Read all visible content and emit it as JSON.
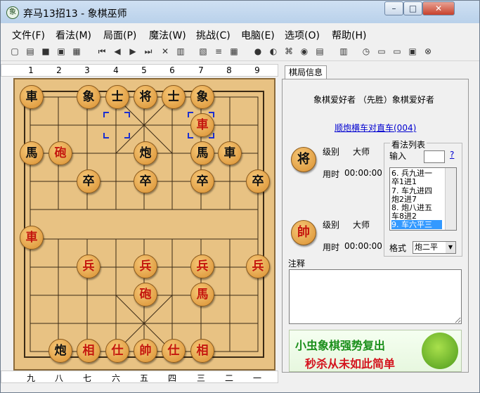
{
  "window": {
    "title": "弃马13招13 - 象棋巫师",
    "app_icon": "象"
  },
  "menu": [
    "文件(F)",
    "看法(M)",
    "局面(P)",
    "魔法(W)",
    "挑战(C)",
    "电脑(E)",
    "选项(O)",
    "帮助(H)"
  ],
  "coords_top": [
    "1",
    "2",
    "3",
    "4",
    "5",
    "6",
    "7",
    "8",
    "9"
  ],
  "coords_bottom": [
    "九",
    "八",
    "七",
    "六",
    "五",
    "四",
    "三",
    "二",
    "一"
  ],
  "pieces": {
    "r1": [
      "車",
      "象",
      "士",
      "将",
      "士",
      "象"
    ],
    "r2": [
      "車"
    ],
    "r3": [
      "馬",
      "砲",
      "炮",
      "馬",
      "車"
    ],
    "r4": [
      "卒",
      "卒",
      "卒",
      "卒"
    ],
    "r5": [
      "車"
    ],
    "r6": [
      "兵",
      "兵",
      "兵",
      "兵"
    ],
    "r7": [
      "砲",
      "馬"
    ],
    "r8": [
      "炮",
      "相",
      "仕",
      "帥",
      "仕",
      "相"
    ]
  },
  "panel": {
    "tab": "棋局信息",
    "players": "象棋爱好者 （先胜）象棋爱好者",
    "opening": "顺炮横车对直车(004)",
    "upper_piece": "将",
    "lower_piece": "帥",
    "level_label": "级别",
    "level_value": "大师",
    "time_label": "用时",
    "time_upper": "00:00:00",
    "time_lower": "00:00:00",
    "movelist_title": "看法列表",
    "input_label": "输入",
    "help_icon": "?",
    "moves": [
      "6. 兵九进一",
      "卒1进1",
      "7. 车九进四",
      "炮2进7",
      "8. 炮八进五",
      "车8进2",
      "9. 车六平三"
    ],
    "format_label": "格式",
    "format_value": "炮二平",
    "comment_label": "注释",
    "ad_line1": "小虫象棋强势复出",
    "ad_line2": "秒杀从未如此简单"
  }
}
